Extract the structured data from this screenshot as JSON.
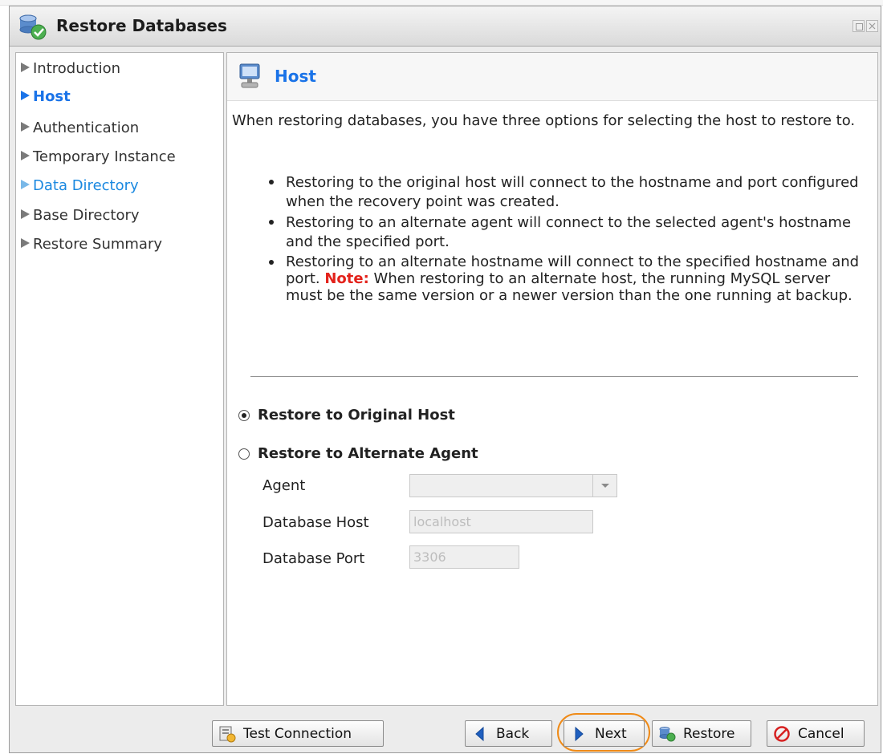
{
  "window": {
    "title": "Restore Databases"
  },
  "nav": {
    "items": [
      {
        "label": "Introduction",
        "state": "normal"
      },
      {
        "label": "Host",
        "state": "active"
      },
      {
        "label": "Authentication",
        "state": "normal"
      },
      {
        "label": "Temporary Instance",
        "state": "normal"
      },
      {
        "label": "Data Directory",
        "state": "link"
      },
      {
        "label": "Base Directory",
        "state": "normal"
      },
      {
        "label": "Restore Summary",
        "state": "normal"
      }
    ]
  },
  "content": {
    "title": "Host",
    "intro": "When restoring databases, you have three options for selecting the host to restore to.",
    "bullets": {
      "b1": "Restoring to the original host will connect to the hostname and port configured when the recovery point was created.",
      "b2": "Restoring to an alternate agent will connect to the selected agent's hostname and the specified port.",
      "b3_pre": "Restoring to an alternate hostname will connect to the specified hostname and port. ",
      "b3_note": "Note:",
      "b3_post": " When restoring to an alternate host, the running MySQL server must be the same version or a newer version than the one running at backup."
    },
    "options": {
      "original": {
        "label": "Restore to Original Host",
        "checked": true
      },
      "alternate": {
        "label": "Restore to Alternate Agent",
        "checked": false
      }
    },
    "fields": {
      "agent": {
        "label": "Agent",
        "value": ""
      },
      "db_host": {
        "label": "Database Host",
        "value": "localhost"
      },
      "db_port": {
        "label": "Database Port",
        "value": "3306"
      }
    }
  },
  "footer": {
    "test_connection": "Test Connection",
    "back": "Back",
    "next": "Next",
    "restore": "Restore",
    "cancel": "Cancel"
  },
  "colors": {
    "active": "#1a73e8",
    "note": "#e3221b",
    "highlight": "#ef8a17"
  }
}
